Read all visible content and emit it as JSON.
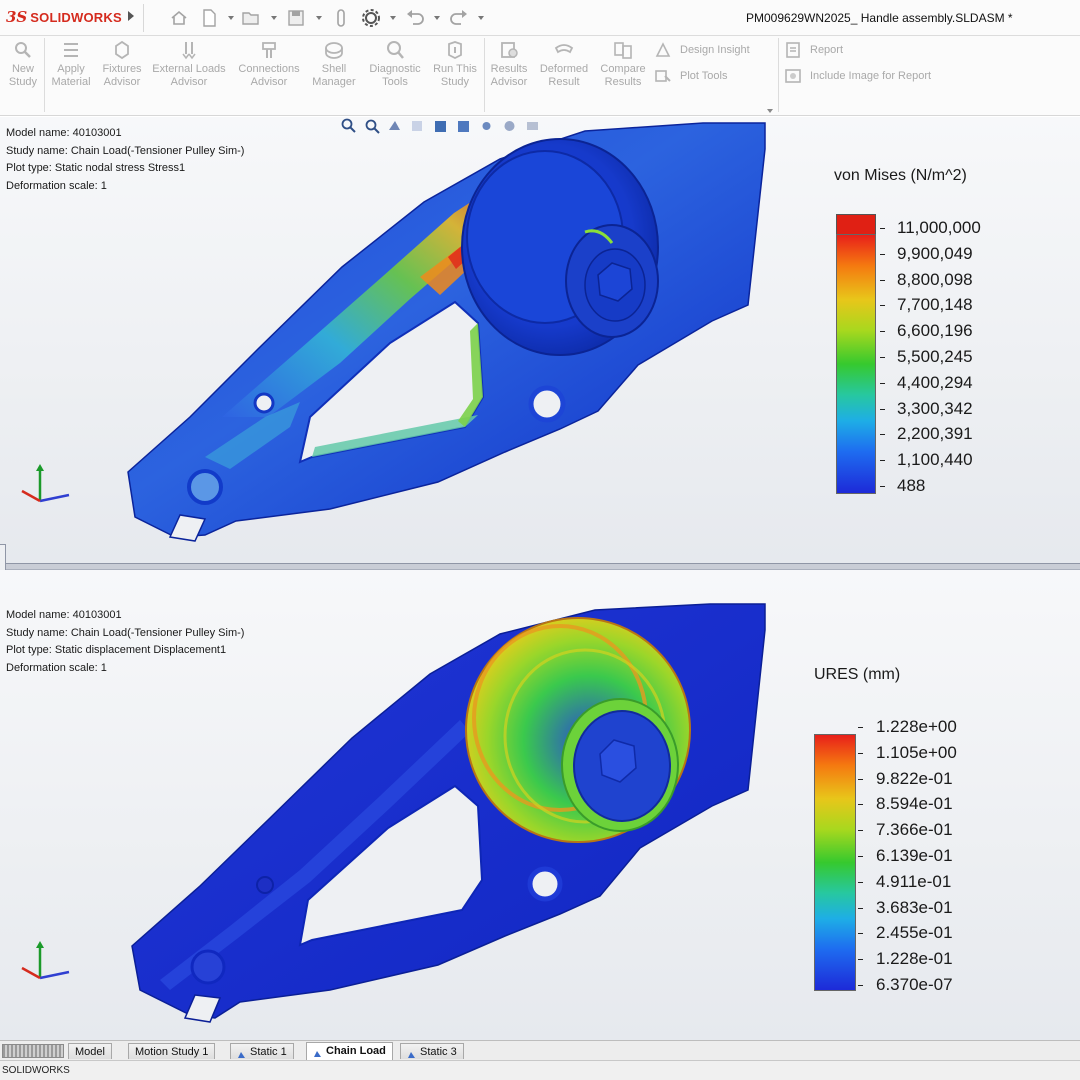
{
  "app": {
    "brand_mark": "3S",
    "brand_name": "SOLIDWORKS",
    "document_title": "PM009629WN2025_ Handle assembly.SLDASM *",
    "colors": {
      "brand": "#d52b1e",
      "ribbon_text_disabled": "#a9a9a9"
    }
  },
  "quick_access": {
    "icons": [
      "home-icon",
      "new-document-icon",
      "open-icon",
      "save-icon",
      "attach-icon",
      "settings-gear-icon",
      "undo-icon",
      "redo-icon"
    ]
  },
  "ribbon": {
    "buttons": [
      {
        "line1": "New",
        "line2": "Study",
        "icon": "new-study-icon"
      },
      {
        "line1": "Apply",
        "line2": "Material",
        "icon": "apply-material-icon"
      },
      {
        "line1": "Fixtures",
        "line2": "Advisor",
        "icon": "fixtures-advisor-icon"
      },
      {
        "line1": "External Loads",
        "line2": "Advisor",
        "icon": "external-loads-icon"
      },
      {
        "line1": "Connections",
        "line2": "Advisor",
        "icon": "connections-advisor-icon"
      },
      {
        "line1": "Shell",
        "line2": "Manager",
        "icon": "shell-manager-icon"
      },
      {
        "line1": "Diagnostic",
        "line2": "Tools",
        "icon": "diagnostic-tools-icon"
      },
      {
        "line1": "Run This",
        "line2": "Study",
        "icon": "run-study-icon"
      },
      {
        "line1": "Results",
        "line2": "Advisor",
        "icon": "results-advisor-icon"
      },
      {
        "line1": "Deformed",
        "line2": "Result",
        "icon": "deformed-result-icon"
      },
      {
        "line1": "Compare",
        "line2": "Results",
        "icon": "compare-results-icon"
      }
    ],
    "design_insight": "Design Insight",
    "plot_tools": "Plot Tools",
    "report": "Report",
    "include_image": "Include Image for Report"
  },
  "top_view": {
    "info": {
      "model_name": "Model name: 40103001",
      "study_name": "Study name: Chain Load(-Tensioner Pulley Sim-)",
      "plot_type": "Plot type: Static nodal stress Stress1",
      "deformation_scale": "Deformation scale: 1"
    },
    "legend": {
      "title": "von Mises (N/m^2)",
      "labels": [
        "11,000,000",
        "9,900,049",
        "8,800,098",
        "7,700,148",
        "6,600,196",
        "5,500,245",
        "4,400,294",
        "3,300,342",
        "2,200,391",
        "1,100,440",
        "488"
      ]
    }
  },
  "bottom_view": {
    "info": {
      "model_name": "Model name: 40103001",
      "study_name": "Study name: Chain Load(-Tensioner Pulley Sim-)",
      "plot_type": "Plot type: Static displacement Displacement1",
      "deformation_scale": "Deformation scale: 1"
    },
    "legend": {
      "title": "URES (mm)",
      "labels": [
        "1.228e+00",
        "1.105e+00",
        "9.822e-01",
        "8.594e-01",
        "7.366e-01",
        "6.139e-01",
        "4.911e-01",
        "3.683e-01",
        "2.455e-01",
        "1.228e-01",
        "6.370e-07"
      ]
    }
  },
  "tabs": {
    "items": [
      "Model",
      "Motion Study 1",
      "Static 1",
      "Chain Load",
      "Static 3"
    ],
    "active": "Chain Load"
  },
  "status": {
    "text": "SOLIDWORKS"
  }
}
